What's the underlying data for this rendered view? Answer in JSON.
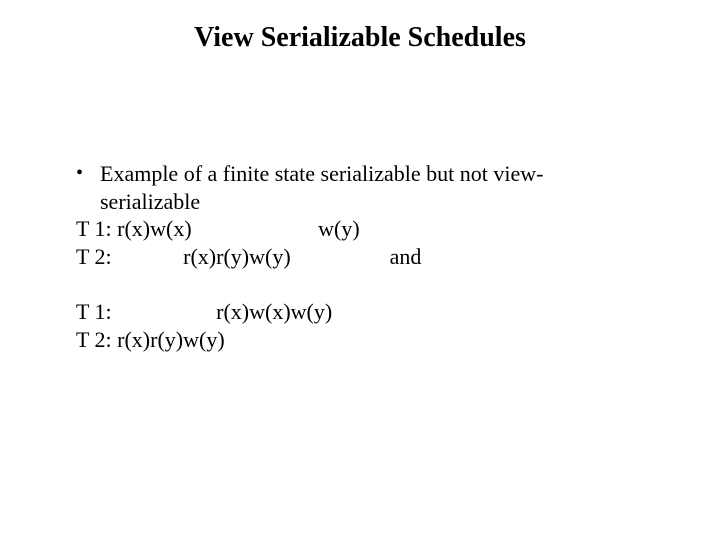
{
  "title": "View Serializable Schedules",
  "bullet": {
    "marker": "•",
    "text": "Example of a finite state serializable but not view-serializable"
  },
  "schedule1": {
    "line1": "T 1: r(x)w(x)                       w(y)",
    "line2": "T 2:             r(x)r(y)w(y)                  and"
  },
  "schedule2": {
    "line1": "T 1:                   r(x)w(x)w(y)",
    "line2": "T 2: r(x)r(y)w(y)"
  }
}
